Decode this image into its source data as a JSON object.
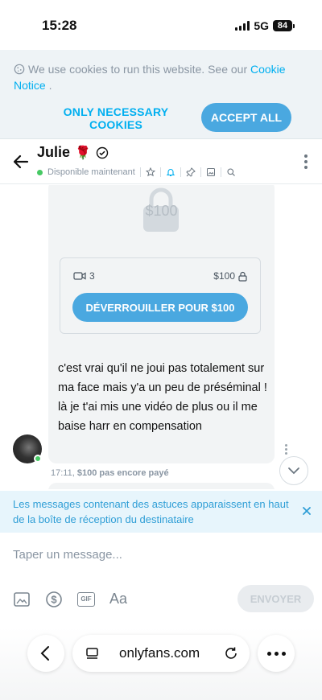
{
  "status_bar": {
    "time": "15:28",
    "network": "5G",
    "battery": "84"
  },
  "cookie_banner": {
    "text": "We use cookies to run this website. See our ",
    "link_text": "Cookie Notice",
    "link_suffix": " .",
    "necessary_label": "ONLY NECESSARY COOKIES",
    "accept_label": "ACCEPT ALL"
  },
  "chat_header": {
    "name": "Julie",
    "emoji": "🌹",
    "status": "Disponible maintenant",
    "icons": [
      "star-icon",
      "bell-icon",
      "pin-icon",
      "image-icon",
      "search-icon"
    ]
  },
  "message": {
    "locked_price_ghost": "$100",
    "video_count": "3",
    "price": "$100",
    "unlock_label": "DÉVERROUILLER POUR $100",
    "text": "c'est vrai qu'il ne joui pas totalement sur ma face mais y'a un peu de préséminal ! là je t'ai mis une vidéo de plus ou il me baise harr en compensation",
    "time": "17:11,",
    "meta_status": "$100 pas encore payé"
  },
  "tip_banner": {
    "text": "Les messages contenant des astuces apparaissent en haut de la boîte de réception du destinataire"
  },
  "composer": {
    "placeholder": "Taper un message...",
    "gif_label": "GIF",
    "format_label": "Aa",
    "send_label": "ENVOYER"
  },
  "browser": {
    "url": "onlyfans.com"
  },
  "colors": {
    "accent": "#00aff0",
    "button": "#4aa8e0",
    "online": "#47c964",
    "muted": "#8a96a3"
  }
}
